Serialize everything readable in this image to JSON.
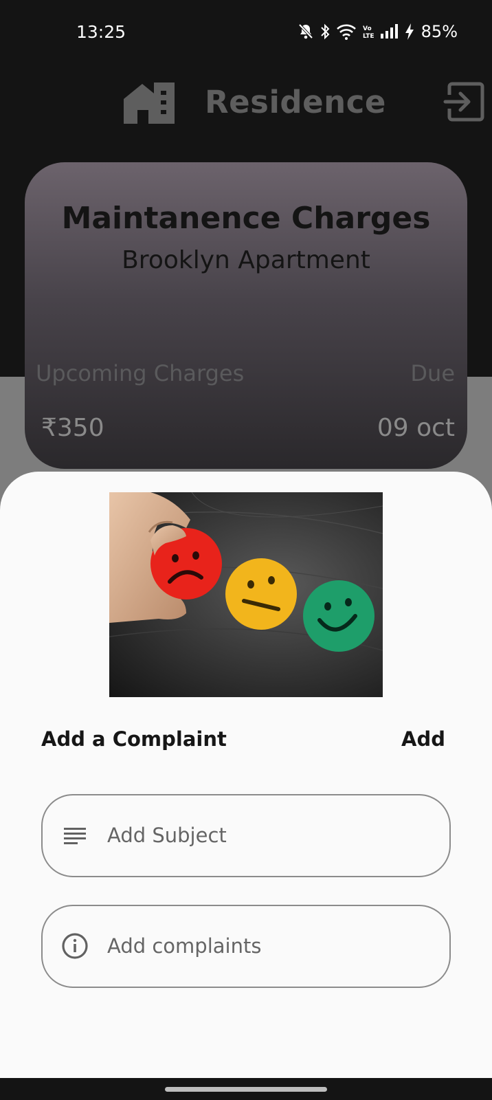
{
  "status_bar": {
    "time": "13:25",
    "battery": "85%",
    "icons": [
      "bell-muted-icon",
      "bluetooth-icon",
      "wifi-icon",
      "volte-icon",
      "signal-icon",
      "charging-icon"
    ]
  },
  "header": {
    "title": "Residence",
    "logo_icon": "house-building-icon",
    "logout_icon": "logout-icon"
  },
  "charges_card": {
    "title": "Maintanence Charges",
    "subtitle": "Brooklyn Apartment",
    "upcoming_label": "Upcoming Charges",
    "due_label": "Due",
    "amount": "₹350",
    "due_date": "09 oct"
  },
  "complaint_sheet": {
    "image_icon": "feedback-faces-image",
    "title": "Add a Complaint",
    "add_label": "Add",
    "subject": {
      "placeholder": "Add Subject",
      "value": "",
      "icon": "subject-lines-icon"
    },
    "complaints": {
      "placeholder": "Add complaints",
      "value": "",
      "icon": "info-icon"
    }
  },
  "colors": {
    "background": "#141414",
    "sheet": "#fafafa",
    "header_title": "#5e5e5e",
    "card_gradient_top": "#6c636c",
    "card_gradient_bottom": "#2a282b",
    "sad_face": "#e8231b",
    "neutral_face": "#f2b51c",
    "happy_face": "#1e9e6a"
  }
}
